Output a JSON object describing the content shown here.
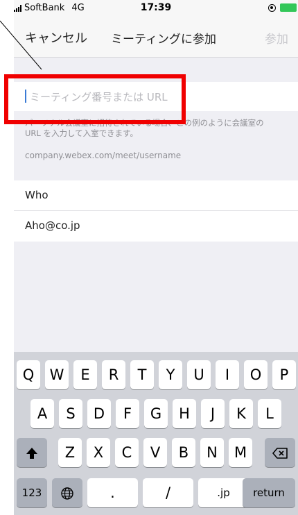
{
  "status": {
    "carrier": "SoftBank",
    "network": "4G",
    "time": "17:39"
  },
  "nav": {
    "cancel": "キャンセル",
    "title": "ミーティングに参加",
    "join": "参加"
  },
  "meeting": {
    "placeholder": "ミーティング番号または URL",
    "helper_line1": "パーソナル会議室に招待されている場合、この例のように会議室の",
    "helper_line2": "URL を入力して入室できます。",
    "example": "company.webex.com/meet/username",
    "name_value": "Who",
    "email_value": "Aho@co.jp"
  },
  "keyboard": {
    "row1": [
      "Q",
      "W",
      "E",
      "R",
      "T",
      "Y",
      "U",
      "I",
      "O",
      "P"
    ],
    "row2": [
      "A",
      "S",
      "D",
      "F",
      "G",
      "H",
      "J",
      "K",
      "L"
    ],
    "row3": [
      "Z",
      "X",
      "C",
      "V",
      "B",
      "N",
      "M"
    ],
    "numbers_key": "123",
    "dot_key": ".",
    "slash_key": "/",
    "jp_key": ".jp",
    "return_key": "return"
  },
  "colors": {
    "highlight": "#f00000",
    "keyboard_bg": "#d1d3d9",
    "battery": "#33c759"
  }
}
